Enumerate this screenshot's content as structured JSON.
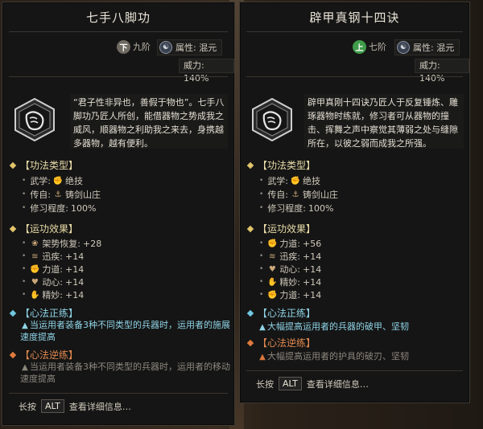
{
  "cards": [
    {
      "title": "七手八脚功",
      "grade_glyph": "下",
      "grade": "九阶",
      "attribute": "属性: 混元",
      "power": "威力: 140%",
      "description": "“君子性非异也，善假于物也”。七手八脚功乃匠人所创，能借器物之势成我之威风，顺器物之利助我之来去，身携越多器物，越有便利。",
      "type_header": "【功法类型】",
      "type_rows": [
        {
          "label": "武学:",
          "value": "绝技"
        },
        {
          "label": "传自:",
          "value": "铸剑山庄"
        },
        {
          "label": "修习程度:",
          "value": "100%"
        }
      ],
      "effect_header": "【运功效果】",
      "effect_rows": [
        {
          "label": "架势恢复:",
          "value": "+28"
        },
        {
          "label": "迅疾:",
          "value": "+14"
        },
        {
          "label": "力道:",
          "value": "+14"
        },
        {
          "label": "动心:",
          "value": "+14"
        },
        {
          "label": "精妙:",
          "value": "+14"
        }
      ],
      "zheng_header": "【心法正练】",
      "zheng_text": "当运用者装备3种不同类型的兵器时，运用者的施展速度提高",
      "ni_header": "【心法逆练】",
      "ni_text": "当运用者装备3种不同类型的兵器时，运用者的移动速度提高",
      "hint_prefix": "长按",
      "hint_key": "ALT",
      "hint_suffix": "查看详细信息…"
    },
    {
      "title": "辟甲真钢十四诀",
      "grade_glyph": "上",
      "grade": "七阶",
      "attribute": "属性: 混元",
      "power": "威力: 140%",
      "description": "辟甲真刚十四诀乃匠人于反复锤炼、雕琢器物时练就，修习者可从器物的撞击、挥舞之声中察觉其薄弱之处与缝隙所在，以彼之弱而成我之所强。",
      "type_header": "【功法类型】",
      "type_rows": [
        {
          "label": "武学:",
          "value": "绝技"
        },
        {
          "label": "传自:",
          "value": "铸剑山庄"
        },
        {
          "label": "修习程度:",
          "value": "100%"
        }
      ],
      "effect_header": "【运功效果】",
      "effect_rows": [
        {
          "label": "力道:",
          "value": "+56"
        },
        {
          "label": "迅疾:",
          "value": "+14"
        },
        {
          "label": "动心:",
          "value": "+14"
        },
        {
          "label": "精妙:",
          "value": "+14"
        },
        {
          "label": "力道:",
          "value": "+14"
        }
      ],
      "zheng_header": "【心法正练】",
      "zheng_text": "大幅提高运用者的兵器的破甲、坚韧",
      "ni_header": "【心法逆练】",
      "ni_text": "大幅提高运用者的护具的破刃、坚韧",
      "hint_prefix": "长按",
      "hint_key": "ALT",
      "hint_suffix": "查看详细信息…"
    }
  ],
  "colors": {
    "grade_low": "#6f6a62",
    "grade_high": "#3f9b4a",
    "type_header": "#e9dca8",
    "zheng_header": "#8fd4e6",
    "ni_header": "#e2894f"
  },
  "icons": {
    "emblem": "fist-emblem-icon",
    "attribute": "yin-yang-icon",
    "martial": "red-fist-icon",
    "origin": "sword-manor-icon"
  }
}
